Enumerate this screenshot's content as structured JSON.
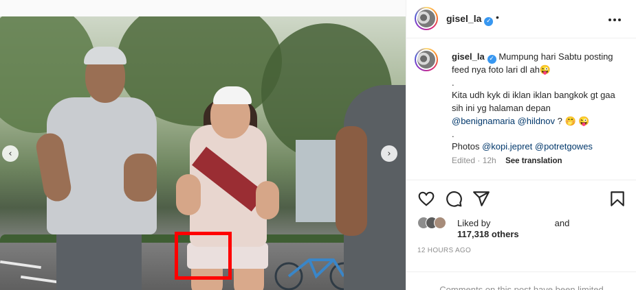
{
  "header": {
    "username": "gisel_la",
    "separator": "•",
    "more_icon": "ellipsis-icon"
  },
  "caption": {
    "username": "gisel_la",
    "line1": "Mumpung hari Sabtu posting feed nya foto lari dl ah",
    "emoji1": "😜",
    "dot1": ".",
    "line2": "Kita udh kyk di iklan iklan bangkok gt gaa sih ini yg halaman depan",
    "mention1": "@benignamaria",
    "mention2": "@hildnov",
    "line3_suffix": " ?",
    "emoji2": "🤭 😜",
    "dot2": ".",
    "photos_label": "Photos ",
    "mention3": "@kopi.jepret",
    "mention4": "@potretgowes"
  },
  "meta": {
    "edited": "Edited · 12h",
    "see_translation": "See translation"
  },
  "actions": {
    "like_icon": "heart-icon",
    "comment_icon": "comment-icon",
    "share_icon": "send-icon",
    "save_icon": "bookmark-icon"
  },
  "likes": {
    "liked_by_prefix": "Liked by",
    "and": "and",
    "count": "117,318 others"
  },
  "time_ago": "12 HOURS AGO",
  "comments_limited": "Comments on this post have been limited",
  "carousel": {
    "prev_icon": "chevron-left-icon",
    "next_icon": "chevron-right-icon",
    "prev_glyph": "‹",
    "next_glyph": "›"
  },
  "colors": {
    "highlight_box": "#ff0000",
    "link": "#00376b",
    "verified": "#3897f0"
  }
}
